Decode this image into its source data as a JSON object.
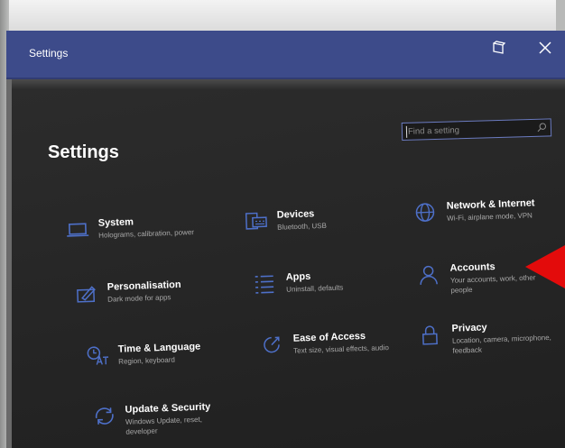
{
  "window": {
    "title": "Settings"
  },
  "page": {
    "title": "Settings"
  },
  "search": {
    "placeholder": "Find a setting"
  },
  "categories": [
    {
      "name": "System",
      "desc": "Holograms, calibration, power",
      "icon": "laptop-icon"
    },
    {
      "name": "Devices",
      "desc": "Bluetooth, USB",
      "icon": "devices-icon"
    },
    {
      "name": "Network & Internet",
      "desc": "Wi-Fi, airplane mode, VPN",
      "icon": "globe-icon"
    },
    {
      "name": "Personalisation",
      "desc": "Dark mode for apps",
      "icon": "personalisation-icon"
    },
    {
      "name": "Apps",
      "desc": "Uninstall, defaults",
      "icon": "apps-list-icon"
    },
    {
      "name": "Accounts",
      "desc": "Your accounts, work, other people",
      "icon": "person-icon"
    },
    {
      "name": "Time & Language",
      "desc": "Region, keyboard",
      "icon": "time-language-icon"
    },
    {
      "name": "Ease of Access",
      "desc": "Text size, visual effects, audio",
      "icon": "ease-of-access-icon"
    },
    {
      "name": "Privacy",
      "desc": "Location, camera, microphone, feedback",
      "icon": "lock-icon"
    },
    {
      "name": "Update & Security",
      "desc": "Windows Update, reset, developer",
      "icon": "sync-icon"
    }
  ],
  "colors": {
    "titlebar": "#3d4b8a",
    "accent": "#4e70c9",
    "background": "#252525",
    "arrow": "#e30b0b"
  }
}
